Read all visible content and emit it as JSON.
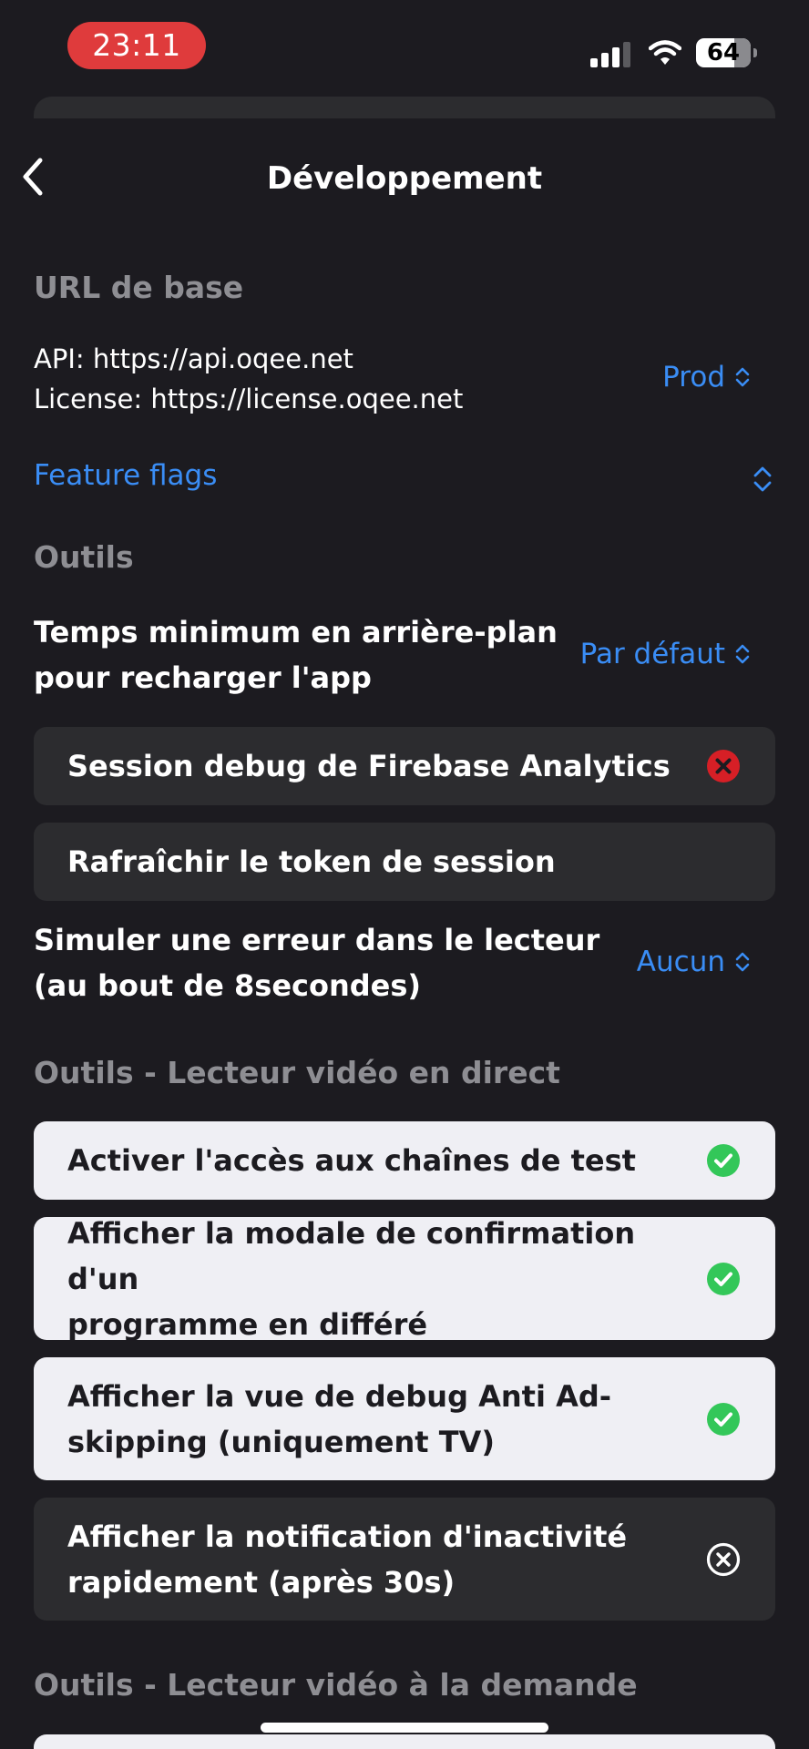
{
  "status_bar": {
    "time": "23:11",
    "battery": "64"
  },
  "nav": {
    "title": "Développement"
  },
  "base_url": {
    "header": "URL de base",
    "api_line": "API: https://api.oqee.net",
    "license_line": "License: https://license.oqee.net",
    "env_value": "Prod"
  },
  "feature_flags": {
    "label": "Feature flags"
  },
  "tools": {
    "header": "Outils",
    "min_background_line1": "Temps minimum en arrière-plan",
    "min_background_line2": "pour recharger l'app",
    "min_background_value": "Par défaut",
    "firebase_debug": "Session debug de Firebase Analytics",
    "refresh_token": "Rafraîchir le token de session",
    "simulate_error_line1": "Simuler une erreur dans le lecteur",
    "simulate_error_line2": "(au bout de 8secondes)",
    "simulate_error_value": "Aucun"
  },
  "live_player": {
    "header": "Outils - Lecteur vidéo en direct",
    "items": [
      {
        "label": "Activer l'accès aux chaînes de test",
        "enabled": true
      },
      {
        "label_line1": "Afficher la modale de confirmation d'un",
        "label_line2": "programme en différé",
        "enabled": true
      },
      {
        "label_line1": "Afficher la vue de debug Anti Ad-",
        "label_line2": "skipping (uniquement TV)",
        "enabled": true
      },
      {
        "label_line1": "Afficher la notification d'inactivité",
        "label_line2": "rapidement (après 30s)",
        "enabled": false
      }
    ]
  },
  "vod_player": {
    "header": "Outils - Lecteur vidéo à la demande"
  },
  "colors": {
    "background": "#1c1b20",
    "accent_blue": "#3a8df5",
    "success_green": "#33c759",
    "error_red": "#d61f26",
    "time_pill_red": "#df3b3c"
  }
}
